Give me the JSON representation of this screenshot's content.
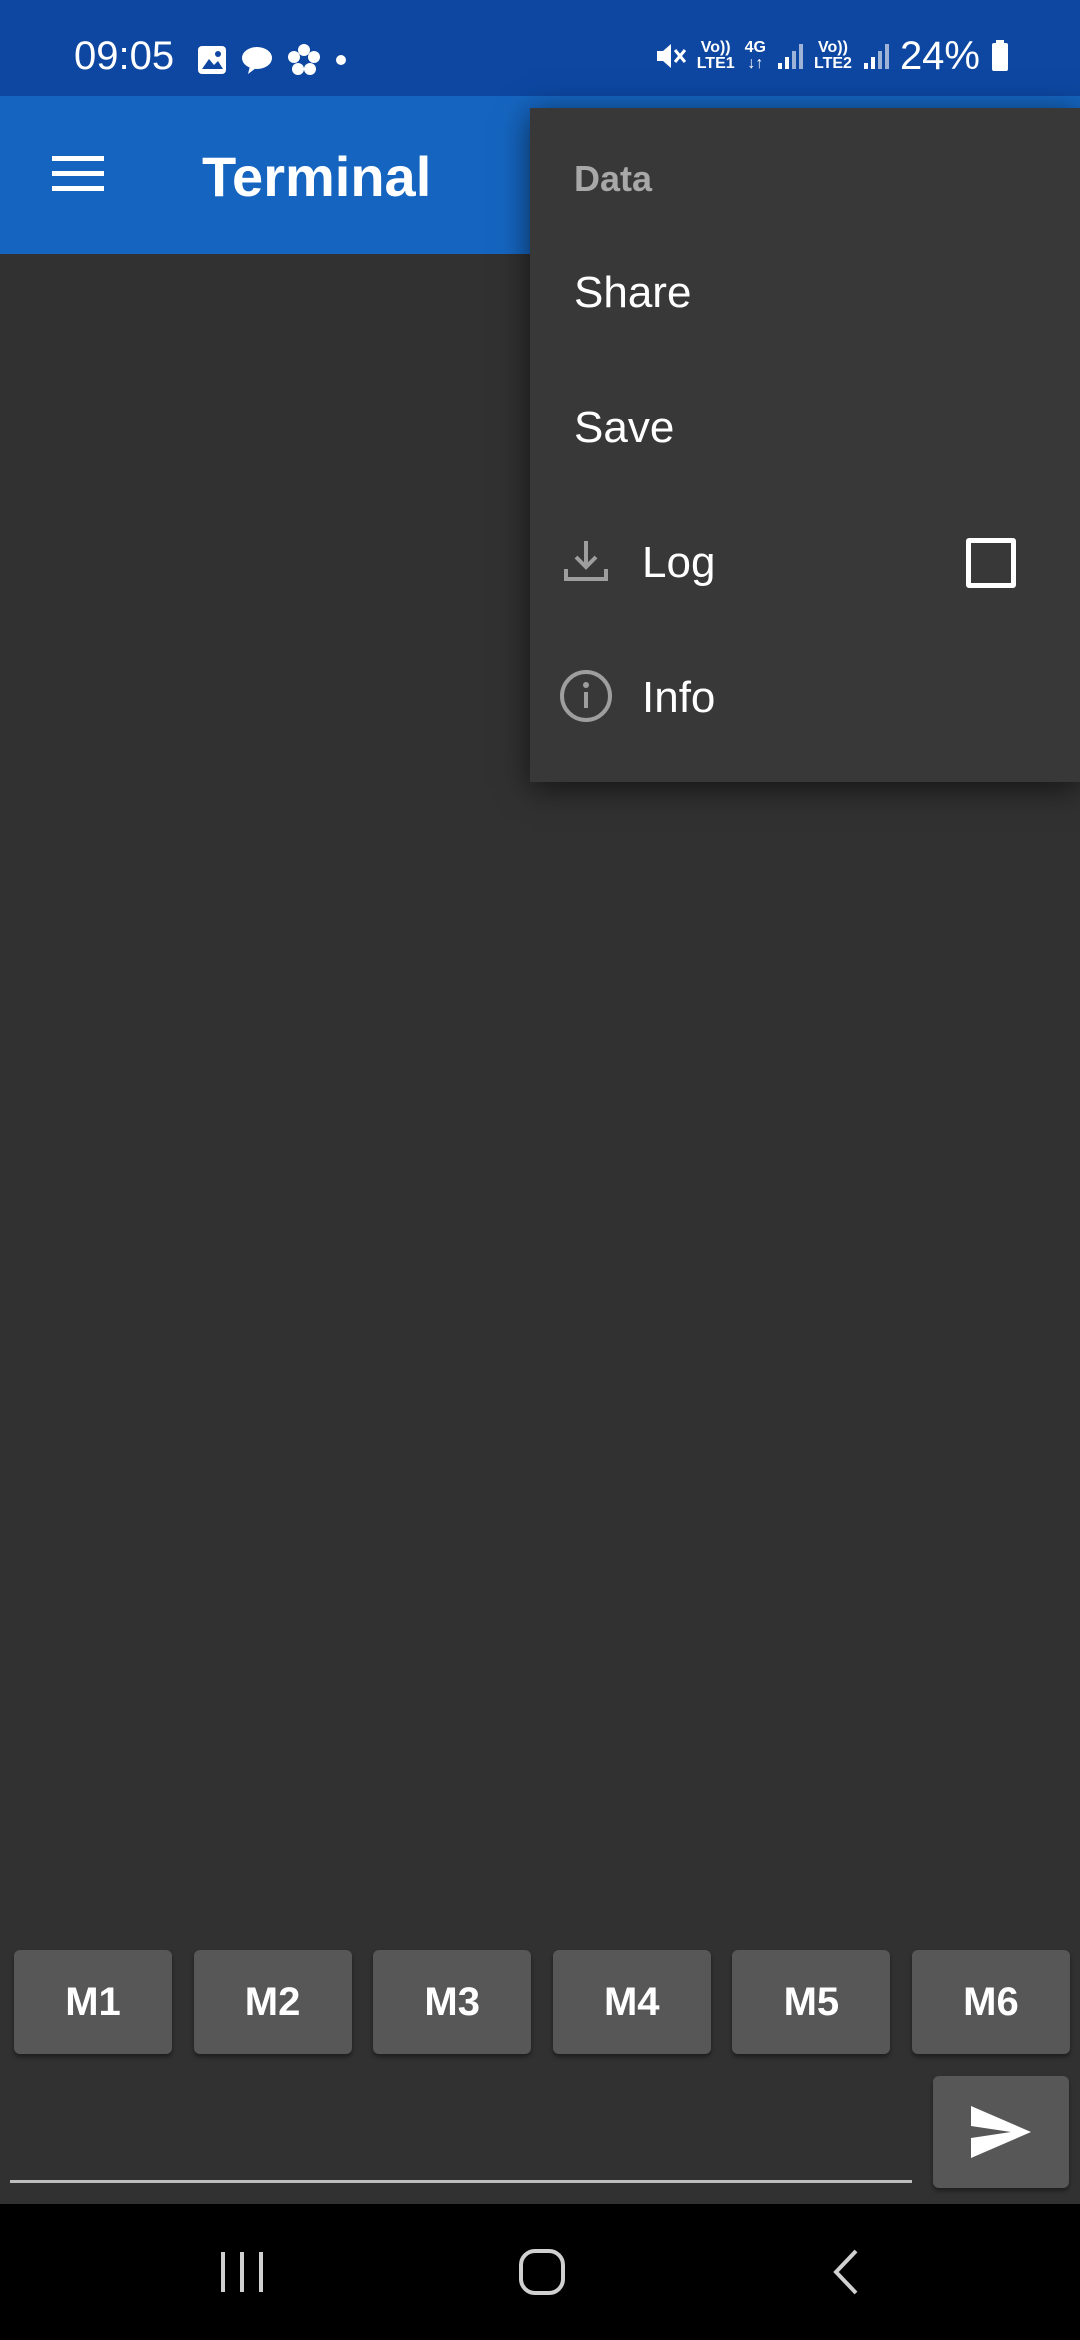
{
  "status_bar": {
    "time": "09:05",
    "battery": "24%",
    "sim1_label": "LTE1",
    "sim2_label": "LTE2",
    "network_type": "4G",
    "volte": "Vo))"
  },
  "app_bar": {
    "title": "Terminal"
  },
  "overflow_menu": {
    "header": "Data",
    "items": [
      {
        "label": "Share",
        "icon": ""
      },
      {
        "label": "Save",
        "icon": ""
      },
      {
        "label": "Log",
        "icon": "download-icon",
        "checked": false
      },
      {
        "label": "Info",
        "icon": "info-icon"
      }
    ]
  },
  "macros": [
    "M1",
    "M2",
    "M3",
    "M4",
    "M5",
    "M6"
  ],
  "input": {
    "value": "",
    "placeholder": ""
  },
  "colors": {
    "status_bar": "#0d47a1",
    "app_bar": "#1565c0",
    "background": "#313131",
    "menu": "#383838",
    "button": "#575757"
  }
}
